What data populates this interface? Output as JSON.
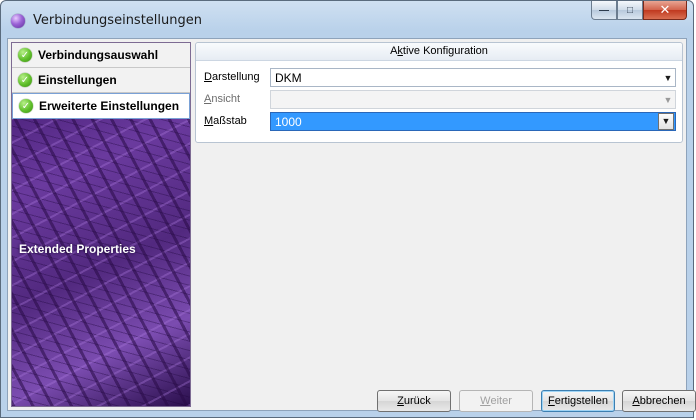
{
  "window": {
    "title": "Verbindungseinstellungen"
  },
  "sidebar": {
    "steps": [
      {
        "label": "Verbindungsauswahl",
        "status": "complete"
      },
      {
        "label": "Einstellungen",
        "status": "complete"
      },
      {
        "label": "Erweiterte Einstellungen",
        "status": "complete",
        "active": true
      }
    ],
    "caption": "Extended Properties"
  },
  "config": {
    "group_title_prefix": "A",
    "group_title_accel": "k",
    "group_title_rest": "tive Konfiguration",
    "fields": [
      {
        "accel": "D",
        "label_rest": "arstellung",
        "value": "DKM",
        "enabled": true
      },
      {
        "accel": "A",
        "label_rest": "nsicht",
        "value": "",
        "enabled": false
      },
      {
        "accel": "M",
        "label_rest": "aßstab",
        "value": "1000",
        "enabled": true,
        "focused": true
      }
    ]
  },
  "buttons": {
    "back": {
      "accel": "Z",
      "rest": "urück",
      "enabled": true
    },
    "next": {
      "accel": "W",
      "rest": "eiter",
      "enabled": false
    },
    "finish": {
      "accel": "F",
      "rest": "ertigstellen",
      "enabled": true,
      "default": true
    },
    "cancel": {
      "accel": "A",
      "rest": "bbrechen",
      "enabled": true
    }
  },
  "icons": {
    "app": "purple-orb-icon",
    "step_status": "green-check-icon"
  },
  "colors": {
    "sidebar_bg": "#52297f",
    "focus_highlight": "#3399ff",
    "check_green": "#5fbf2a"
  }
}
